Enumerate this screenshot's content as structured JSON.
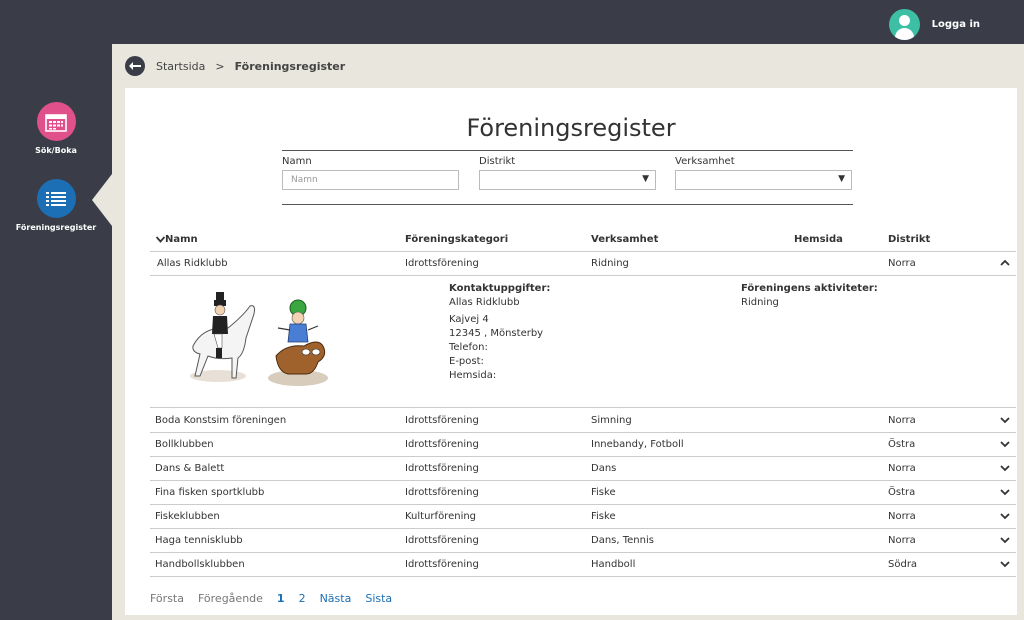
{
  "header": {
    "login_label": "Logga in"
  },
  "sidebar": {
    "items": [
      {
        "label": "Sök/Boka"
      },
      {
        "label": "Föreningsregister"
      }
    ]
  },
  "breadcrumb": {
    "home": "Startsida",
    "separator": ">",
    "current": "Föreningsregister"
  },
  "page": {
    "title": "Föreningsregister"
  },
  "filters": {
    "namn": {
      "label": "Namn",
      "placeholder": "Namn",
      "value": ""
    },
    "distrikt": {
      "label": "Distrikt",
      "value": ""
    },
    "verksamhet": {
      "label": "Verksamhet",
      "value": ""
    }
  },
  "table": {
    "headers": {
      "namn": "Namn",
      "kategori": "Föreningskategori",
      "verksamhet": "Verksamhet",
      "hemsida": "Hemsida",
      "distrikt": "Distrikt"
    },
    "expanded": {
      "namn": "Allas Ridklubb",
      "kategori": "Idrottsförening",
      "verksamhet": "Ridning",
      "hemsida": "",
      "distrikt": "Norra"
    },
    "detail": {
      "contact_heading": "Kontaktuppgifter:",
      "name": "Allas Ridklubb",
      "address1": "Kajvej 4",
      "address2": "12345 , Mönsterby",
      "phone": "Telefon:",
      "email": "E-post:",
      "website": "Hemsida:",
      "activities_heading": "Föreningens aktiviteter:",
      "activities": "Ridning"
    },
    "rows": [
      {
        "namn": "Boda Konstsim föreningen",
        "kategori": "Idrottsförening",
        "verksamhet": "Simning",
        "distrikt": "Norra"
      },
      {
        "namn": "Bollklubben",
        "kategori": "Idrottsförening",
        "verksamhet": "Innebandy, Fotboll",
        "distrikt": "Östra"
      },
      {
        "namn": "Dans & Balett",
        "kategori": "Idrottsförening",
        "verksamhet": "Dans",
        "distrikt": "Norra"
      },
      {
        "namn": "Fina fisken sportklubb",
        "kategori": "Idrottsförening",
        "verksamhet": "Fiske",
        "distrikt": "Östra"
      },
      {
        "namn": "Fiskeklubben",
        "kategori": "Kulturförening",
        "verksamhet": "Fiske",
        "distrikt": "Norra"
      },
      {
        "namn": "Haga tennisklubb",
        "kategori": "Idrottsförening",
        "verksamhet": "Dans, Tennis",
        "distrikt": "Norra"
      },
      {
        "namn": "Handbollsklubben",
        "kategori": "Idrottsförening",
        "verksamhet": "Handboll",
        "distrikt": "Södra"
      }
    ]
  },
  "pager": {
    "first": "Första",
    "prev": "Föregående",
    "page1": "1",
    "page2": "2",
    "next": "Nästa",
    "last": "Sista"
  },
  "colors": {
    "accent": "#1c6fb4",
    "sok_boka": "#e0508a",
    "avatar": "#3cbfa4",
    "dark": "#3a3d47"
  }
}
